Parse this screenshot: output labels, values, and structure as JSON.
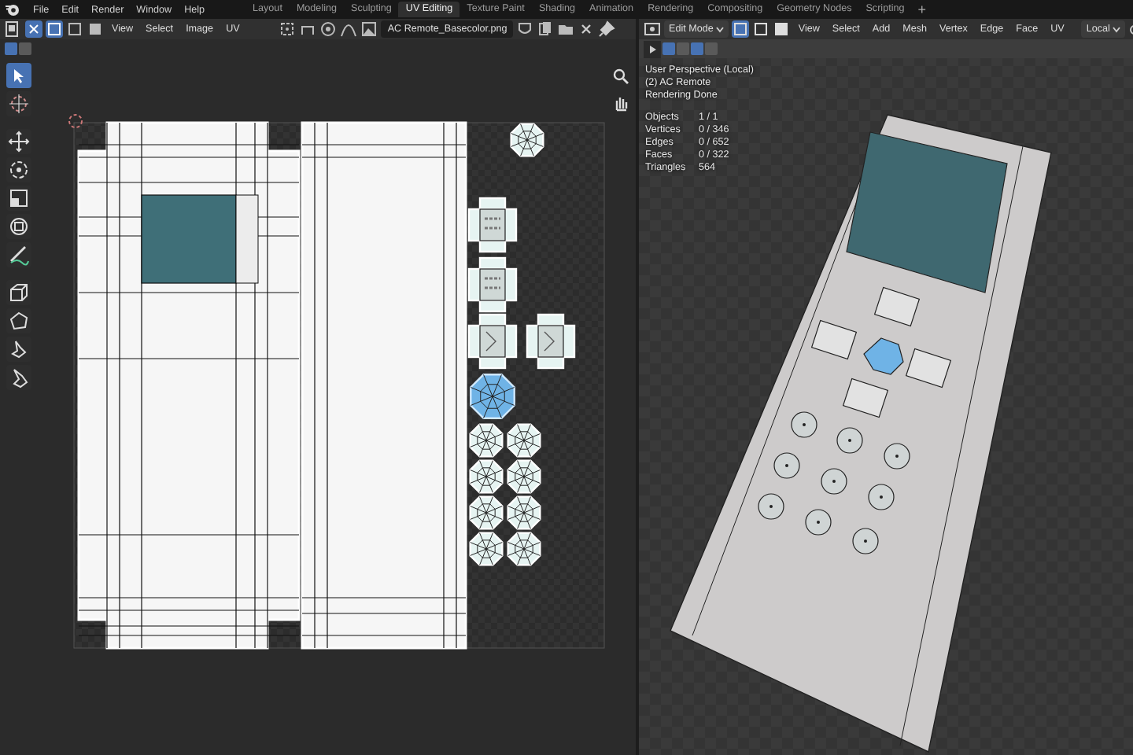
{
  "menu": [
    "File",
    "Edit",
    "Render",
    "Window",
    "Help"
  ],
  "workspaces": [
    {
      "label": "Layout",
      "selected": false
    },
    {
      "label": "Modeling",
      "selected": false
    },
    {
      "label": "Sculpting",
      "selected": false
    },
    {
      "label": "UV Editing",
      "selected": true
    },
    {
      "label": "Texture Paint",
      "selected": false
    },
    {
      "label": "Shading",
      "selected": false
    },
    {
      "label": "Animation",
      "selected": false
    },
    {
      "label": "Rendering",
      "selected": false
    },
    {
      "label": "Compositing",
      "selected": false
    },
    {
      "label": "Geometry Nodes",
      "selected": false
    },
    {
      "label": "Scripting",
      "selected": false
    }
  ],
  "add_workspace": "+",
  "uv_editor": {
    "menus": [
      "View",
      "Select",
      "Image",
      "UV"
    ],
    "image_name": "AC Remote_Basecolor.png",
    "tools": [
      {
        "kind": "select",
        "selected": true
      },
      {
        "kind": "cursor",
        "selected": false
      },
      {
        "kind": "move",
        "selected": false
      },
      {
        "kind": "rotate",
        "selected": false
      },
      {
        "kind": "scale",
        "selected": false
      },
      {
        "kind": "transform",
        "selected": false
      },
      {
        "kind": "annotate",
        "selected": false
      },
      {
        "kind": "rip",
        "selected": false
      },
      {
        "kind": "grab",
        "selected": false
      },
      {
        "kind": "relax",
        "selected": false
      },
      {
        "kind": "pinch",
        "selected": false
      }
    ]
  },
  "viewport": {
    "mode": "Edit Mode",
    "select_modes": [
      {
        "selected": true
      },
      {
        "selected": false
      },
      {
        "selected": false
      }
    ],
    "menus": [
      "View",
      "Select",
      "Add",
      "Mesh",
      "Vertex",
      "Edge",
      "Face",
      "UV"
    ],
    "orientation": "Local",
    "overlay": [
      "User Perspective (Local)",
      "(2) AC Remote",
      "Rendering Done"
    ],
    "stats": [
      {
        "label": "Objects",
        "value": "1 / 1"
      },
      {
        "label": "Vertices",
        "value": "0 / 346"
      },
      {
        "label": "Edges",
        "value": "0 / 652"
      },
      {
        "label": "Faces",
        "value": "0 / 322"
      },
      {
        "label": "Triangles",
        "value": "564"
      }
    ]
  }
}
